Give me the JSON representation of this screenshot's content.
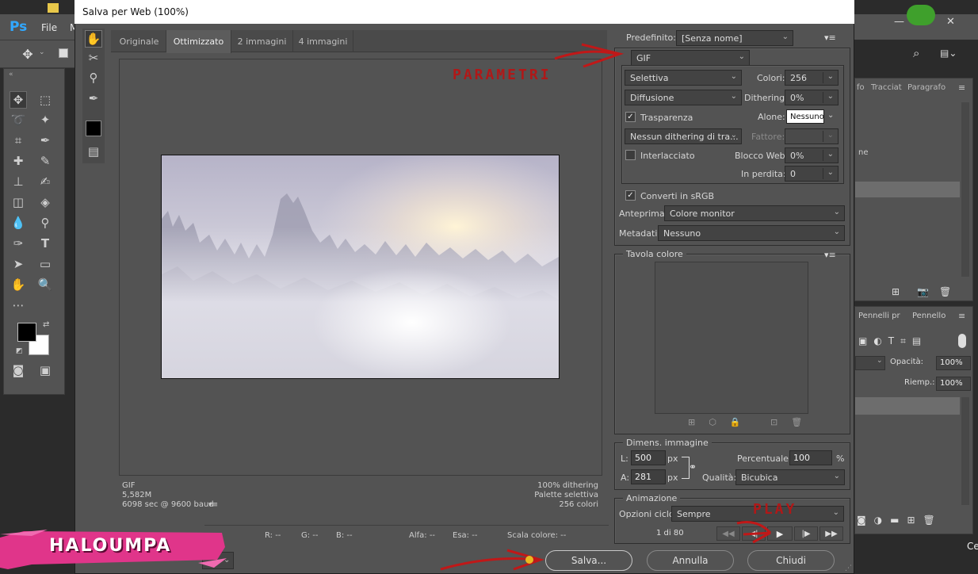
{
  "app": {
    "logo": "Ps",
    "menu_file": "File",
    "menu_more": "M",
    "side_value": "0",
    "taskbar_partial": "Ce",
    "panels": {
      "tab1": "fo",
      "tab2": "Tracciat",
      "tab3": "Paragrafo",
      "row1": "ne",
      "tab_brushes": "Pennelli pr",
      "tab_brush": "Pennello",
      "opacity_label": "Opacità:",
      "opacity_value": "100%",
      "fill_label": "Riemp.:",
      "fill_value": "100%"
    }
  },
  "dialog": {
    "title": "Salva per Web (100%)",
    "tabs": [
      "Originale",
      "Ottimizzato",
      "2 immagini",
      "4 immagini"
    ],
    "preview_info_left": [
      "GIF",
      "5,582M",
      "6098 sec @ 9600 baud"
    ],
    "preview_info_right": [
      "100% dithering",
      "Palette selettiva",
      "256 colori"
    ],
    "zoom_value": "100%",
    "status": {
      "r": "R: --",
      "g": "G: --",
      "b": "B: --",
      "alpha": "Alfa: --",
      "hex": "Esa: --",
      "color_scale": "Scala colore: --"
    },
    "buttons": {
      "save": "Salva...",
      "cancel": "Annulla",
      "close": "Chiudi"
    }
  },
  "settings": {
    "preset_label": "Predefinito:",
    "preset_value": "[Senza nome]",
    "format": "GIF",
    "reduction": "Selettiva",
    "colors_label": "Colori:",
    "colors_value": "256",
    "dither_algo": "Diffusione",
    "dithering_label": "Dithering:",
    "dithering_value": "0%",
    "transparency_label": "Trasparenza",
    "transparency_checked": true,
    "matte_label": "Alone:",
    "matte_value": "Nessuno",
    "transparency_dither": "Nessun dithering di tra...",
    "amount_label": "Fattore:",
    "amount_value": "",
    "interlaced_label": "Interlacciato",
    "interlaced_checked": false,
    "web_snap_label": "Blocco Web:",
    "web_snap_value": "0%",
    "lossy_label": "In perdita:",
    "lossy_value": "0",
    "srgb_label": "Converti in sRGB",
    "srgb_checked": true,
    "preview_label": "Anteprima:",
    "preview_value": "Colore monitor",
    "metadata_label": "Metadati:",
    "metadata_value": "Nessuno",
    "color_table_title": "Tavola colore",
    "image_size_title": "Dimens. immagine",
    "width_label": "L:",
    "width_value": "500",
    "height_label": "A:",
    "height_value": "281",
    "unit_px": "px",
    "percent_label": "Percentuale:",
    "percent_value": "100",
    "percent_unit": "%",
    "quality_label": "Qualità:",
    "quality_value": "Bicubica",
    "animation_title": "Animazione",
    "loop_label": "Opzioni ciclo:",
    "loop_value": "Sempre",
    "frame_counter": "1 di 80"
  },
  "annotations": {
    "parametri": "PARAMETRI",
    "play": "PLAY",
    "brand": "HALOUMPA"
  },
  "colors": {
    "dialog_bg": "#535353",
    "annotation_red": "#b01818",
    "brand_pink": "#e0358a"
  }
}
